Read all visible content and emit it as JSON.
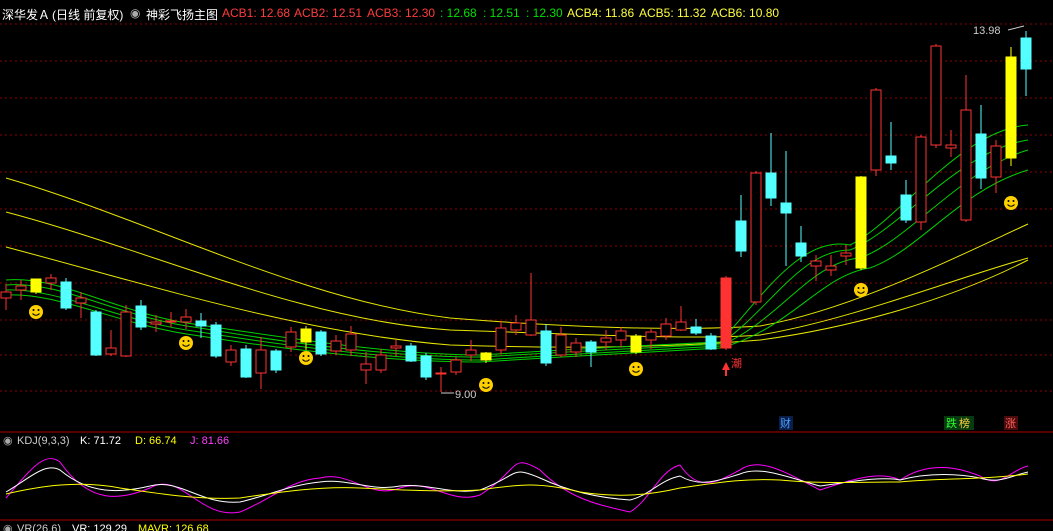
{
  "stock_name": "深华发Ａ",
  "period_info": "(日线 前复权)",
  "indicator_name": "神彩飞扬主图",
  "acb": [
    {
      "label": "ACB1: 12.68"
    },
    {
      "label": "ACB2: 12.51"
    },
    {
      "label": "ACB3: 12.30"
    },
    {
      "label": ": 12.68"
    },
    {
      "label": ": 12.51"
    },
    {
      "label": ": 12.30"
    },
    {
      "label": "ACB4: 11.86"
    },
    {
      "label": "ACB5: 11.32"
    },
    {
      "label": "ACB6: 10.80"
    }
  ],
  "high_label": "13.98",
  "low_label": "9.00",
  "signal_label": "潮",
  "event_tags": [
    "财",
    "跌",
    "榜",
    "涨"
  ],
  "kdj": {
    "name": "KDJ(9,3,3)",
    "k": "K: 71.72",
    "d": "D: 66.74",
    "j": "J: 81.66"
  },
  "vr": {
    "name": "VR(26,6)",
    "vr": "VR: 129.29",
    "mavr": "MAVR: 126.68"
  },
  "colors": {
    "up": "#ff3232",
    "down": "#54ffff",
    "limit": "#ffff00",
    "grid": "#8b0000",
    "ma": "#00d000",
    "long_ma": "#e6e600",
    "k": "#ffffff",
    "d": "#ffff00",
    "j": "#ff00ff"
  }
}
